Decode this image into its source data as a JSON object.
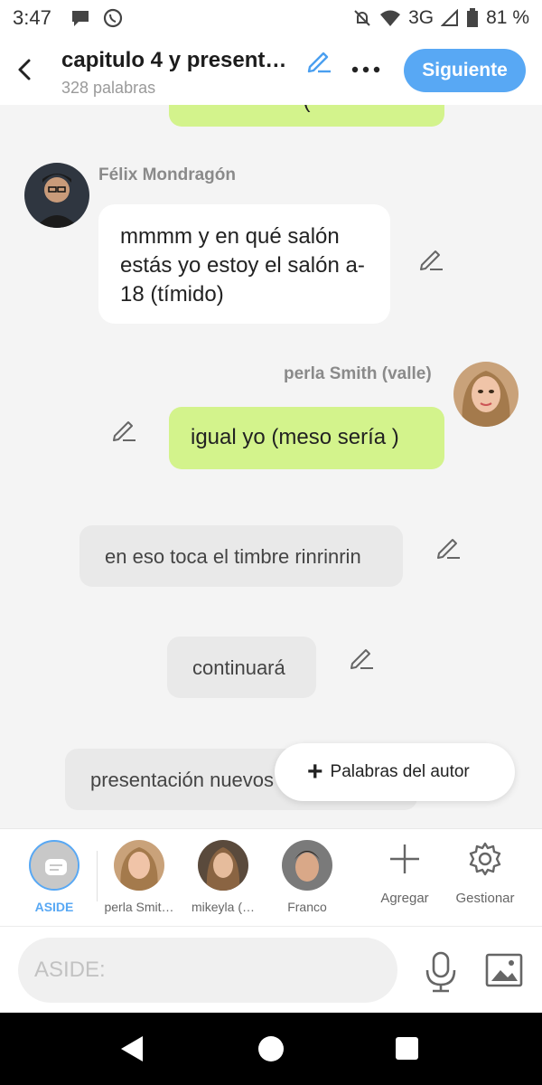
{
  "status_bar": {
    "time": "3:47",
    "network": "3G",
    "battery": "81 %"
  },
  "header": {
    "title": "capitulo 4 y present…",
    "word_count": "328 palabras",
    "next_label": "Siguiente"
  },
  "messages": [
    {
      "side": "right",
      "style": "green",
      "text": "("
    },
    {
      "side": "left",
      "character": "Félix Mondragón",
      "style": "white",
      "text": "mmmm y en qué salón estás yo estoy el salón a-18 (tímido)"
    },
    {
      "side": "right",
      "character": "perla Smith (valle)",
      "style": "green",
      "text": "igual yo (meso sería )"
    },
    {
      "side": "center",
      "style": "gray",
      "text": "en eso toca el timbre rinrinrin"
    },
    {
      "side": "center",
      "style": "gray",
      "text": "continuará"
    },
    {
      "side": "center",
      "style": "gray",
      "text": "presentación nuevos"
    }
  ],
  "author_button": {
    "label": "Palabras del autor"
  },
  "characters": {
    "items": [
      {
        "label": "ASIDE"
      },
      {
        "label": "perla Smit…"
      },
      {
        "label": "mikeyla (…"
      },
      {
        "label": "Franco"
      }
    ],
    "add_label": "Agregar",
    "manage_label": "Gestionar"
  },
  "composer": {
    "placeholder": "ASIDE:"
  },
  "colors": {
    "accent": "#58a8f4",
    "green_bubble": "#d3f38c",
    "gray_bubble": "#e9e9e9"
  }
}
